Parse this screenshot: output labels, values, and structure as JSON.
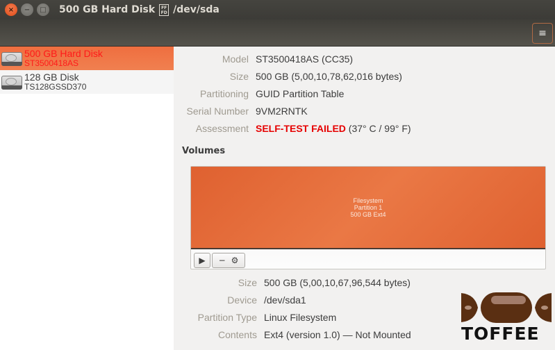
{
  "window": {
    "title": "500 GB Hard Disk",
    "title_glyph": [
      "FF",
      "FD"
    ],
    "device": "/dev/sda",
    "buttons": {
      "close": "×",
      "minimize": "−",
      "maximize": "□"
    }
  },
  "toolbar": {
    "menu_icon": "≡"
  },
  "sidebar": {
    "items": [
      {
        "name": "500 GB Hard Disk",
        "model": "ST3500418AS",
        "selected": true
      },
      {
        "name": "128 GB Disk",
        "model": "TS128GSSD370",
        "selected": false
      }
    ]
  },
  "disk_info": {
    "model": {
      "label": "Model",
      "value": "ST3500418AS (CC35)"
    },
    "size": {
      "label": "Size",
      "value": "500 GB (5,00,10,78,62,016 bytes)"
    },
    "partitioning": {
      "label": "Partitioning",
      "value": "GUID Partition Table"
    },
    "serial": {
      "label": "Serial Number",
      "value": "9VM2RNTK"
    },
    "assessment": {
      "label": "Assessment",
      "status": "SELF-TEST FAILED",
      "detail": " (37° C / 99° F)",
      "status_color": "#e60000"
    }
  },
  "volumes": {
    "title": "Volumes",
    "partition": {
      "line1": "Filesystem",
      "line2": "Partition 1",
      "line3": "500 GB Ext4",
      "color": "#e86f3d"
    },
    "buttons": {
      "play": "▶",
      "minus": "−",
      "gear": "⚙"
    }
  },
  "volume_info": {
    "size": {
      "label": "Size",
      "value": "500 GB (5,00,10,67,96,544 bytes)"
    },
    "device": {
      "label": "Device",
      "value": "/dev/sda1"
    },
    "partition_type": {
      "label": "Partition Type",
      "value": "Linux Filesystem"
    },
    "contents": {
      "label": "Contents",
      "value": "Ext4 (version 1.0) — Not Mounted"
    }
  },
  "watermark": {
    "text": "TOFFEE"
  }
}
